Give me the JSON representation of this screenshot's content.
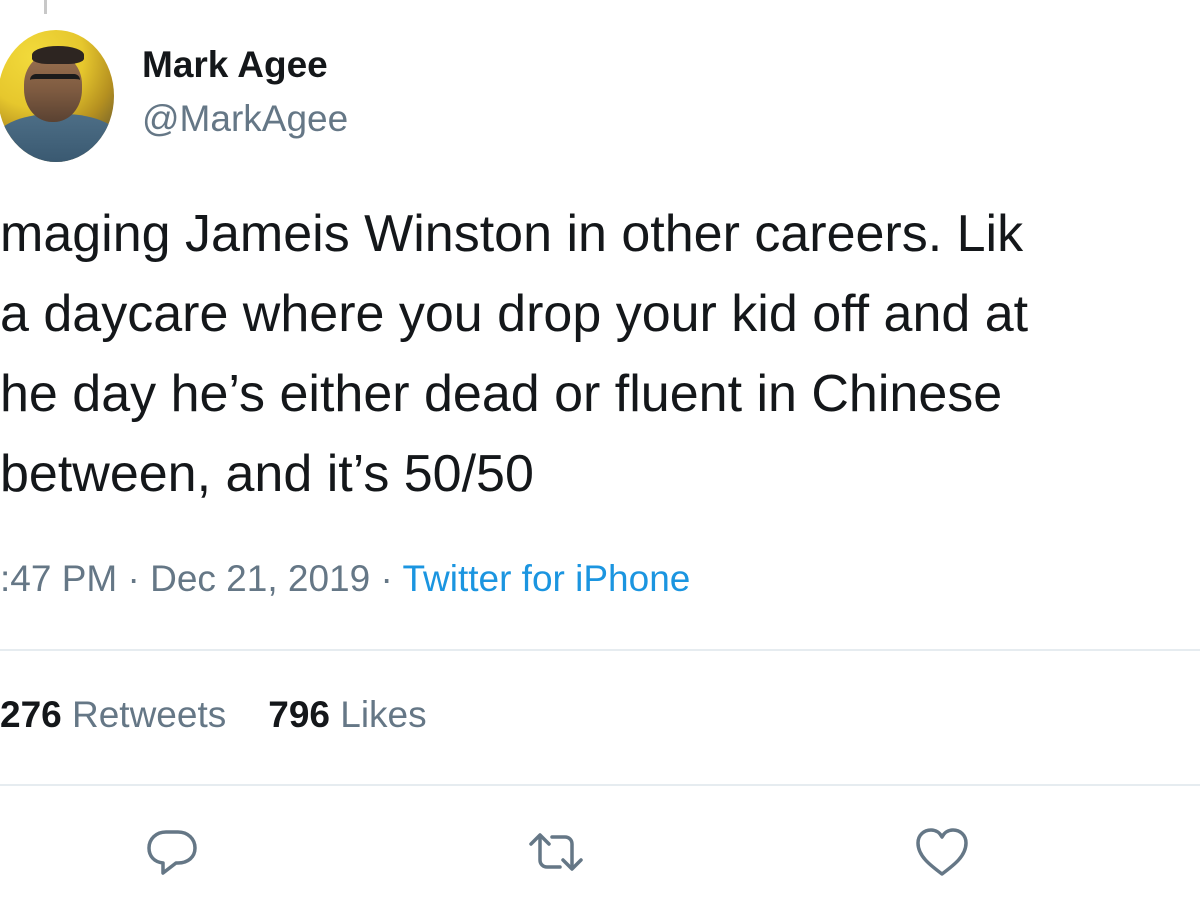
{
  "tweet": {
    "author": {
      "name": "Mark Agee",
      "handle": "@MarkAgee"
    },
    "text_lines": [
      "maging Jameis Winston in other careers. Lik",
      "a daycare where you drop your kid off and at",
      "he day he’s either dead or fluent in Chinese",
      "between, and it’s 50/50"
    ],
    "meta": {
      "time": ":47 PM",
      "separator1": " · ",
      "date": "Dec 21, 2019",
      "separator2": " · ",
      "source": "Twitter for iPhone"
    },
    "stats": {
      "retweets_count": "276",
      "retweets_label": " Retweets",
      "likes_count": "796",
      "likes_label": " Likes"
    },
    "actions": {
      "reply_icon": "reply-icon",
      "retweet_icon": "retweet-icon",
      "like_icon": "heart-icon"
    }
  },
  "colors": {
    "text": "#14171a",
    "secondary": "#657786",
    "link": "#1b95e0",
    "divider": "#e6ecf0"
  }
}
